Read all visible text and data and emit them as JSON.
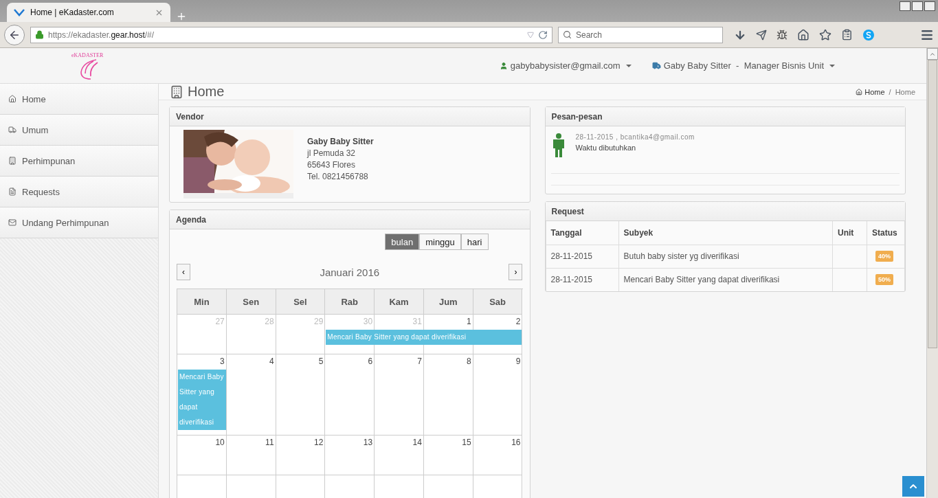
{
  "browser": {
    "tab_title": "Home | eKadaster.com",
    "url_prefix": "https://ekadaster.",
    "url_host": "gear.host",
    "url_suffix": "/#/",
    "search_placeholder": "Search"
  },
  "header": {
    "logo": "eKADASTER",
    "user": "gabybabysister@gmail.com",
    "unit": "Gaby Baby Sitter  -  Manager Bisnis Unit"
  },
  "sidebar": {
    "items": [
      {
        "label": "Home",
        "kind": "home"
      },
      {
        "label": "Umum",
        "kind": "truck"
      },
      {
        "label": "Perhimpunan",
        "kind": "building"
      },
      {
        "label": "Requests",
        "kind": "file"
      },
      {
        "label": "Undang Perhimpunan",
        "kind": "mail"
      }
    ]
  },
  "page": {
    "title": "Home",
    "breadcrumb": [
      "Home",
      "Home"
    ],
    "breadcrumb_separator": "/"
  },
  "vendor": {
    "title": "Vendor",
    "photo": {
      "kind": "picture"
    },
    "name": "Gaby Baby Sitter",
    "lines": [
      "jl Pemuda 32",
      "65643 Flores",
      "Tel. 0821456788"
    ]
  },
  "agenda": {
    "title": "Agenda",
    "views": [
      {
        "label": "bulan",
        "selected": true
      },
      {
        "label": "minggu",
        "selected": false
      },
      {
        "label": "hari",
        "selected": false
      }
    ],
    "prev": "‹",
    "next": "›",
    "month": "Januari 2016",
    "weekdays": [
      "Min",
      "Sen",
      "Sel",
      "Rab",
      "Kam",
      "Jum",
      "Sab"
    ],
    "weeks": [
      {
        "days": [
          {
            "label": "27",
            "muted": true
          },
          {
            "label": "28",
            "muted": true
          },
          {
            "label": "29",
            "muted": true
          },
          {
            "label": "30",
            "muted": true,
            "event": "Mencari Baby Sitter yang dapat diverifikasi"
          },
          {
            "label": "31",
            "muted": true,
            "continued": true
          },
          {
            "label": "1",
            "muted": false,
            "continued": true
          },
          {
            "label": "2",
            "muted": false,
            "continued": true
          }
        ]
      },
      {
        "days": [
          {
            "label": "3",
            "muted": false,
            "event": "Mencari Baby Sitter yang dapat diverifikasi"
          },
          {
            "label": "4",
            "muted": false
          },
          {
            "label": "5",
            "muted": false
          },
          {
            "label": "6",
            "muted": false
          },
          {
            "label": "7",
            "muted": false
          },
          {
            "label": "8",
            "muted": false
          },
          {
            "label": "9",
            "muted": false
          }
        ]
      },
      {
        "days": [
          {
            "label": "10",
            "muted": false
          },
          {
            "label": "11",
            "muted": false
          },
          {
            "label": "12",
            "muted": false
          },
          {
            "label": "13",
            "muted": false
          },
          {
            "label": "14",
            "muted": false
          },
          {
            "label": "15",
            "muted": false
          },
          {
            "label": "16",
            "muted": false
          }
        ]
      }
    ]
  },
  "messages": {
    "title": "Pesan-pesan",
    "items": [
      {
        "meta": "28-11-2015 , bcantika4@gmail.com",
        "text": "Waktu dibutuhkan"
      }
    ]
  },
  "requests": {
    "title": "Request",
    "columns": [
      "Tanggal",
      "Subyek",
      "Unit",
      "Status"
    ],
    "rows": [
      {
        "date": "28-11-2015",
        "subject": "Butuh baby sister yg diverifikasi",
        "status": "40%"
      },
      {
        "date": "28-11-2015",
        "subject": "Mencari Baby Sitter yang dapat diverifikasi",
        "status": "50%"
      }
    ]
  }
}
